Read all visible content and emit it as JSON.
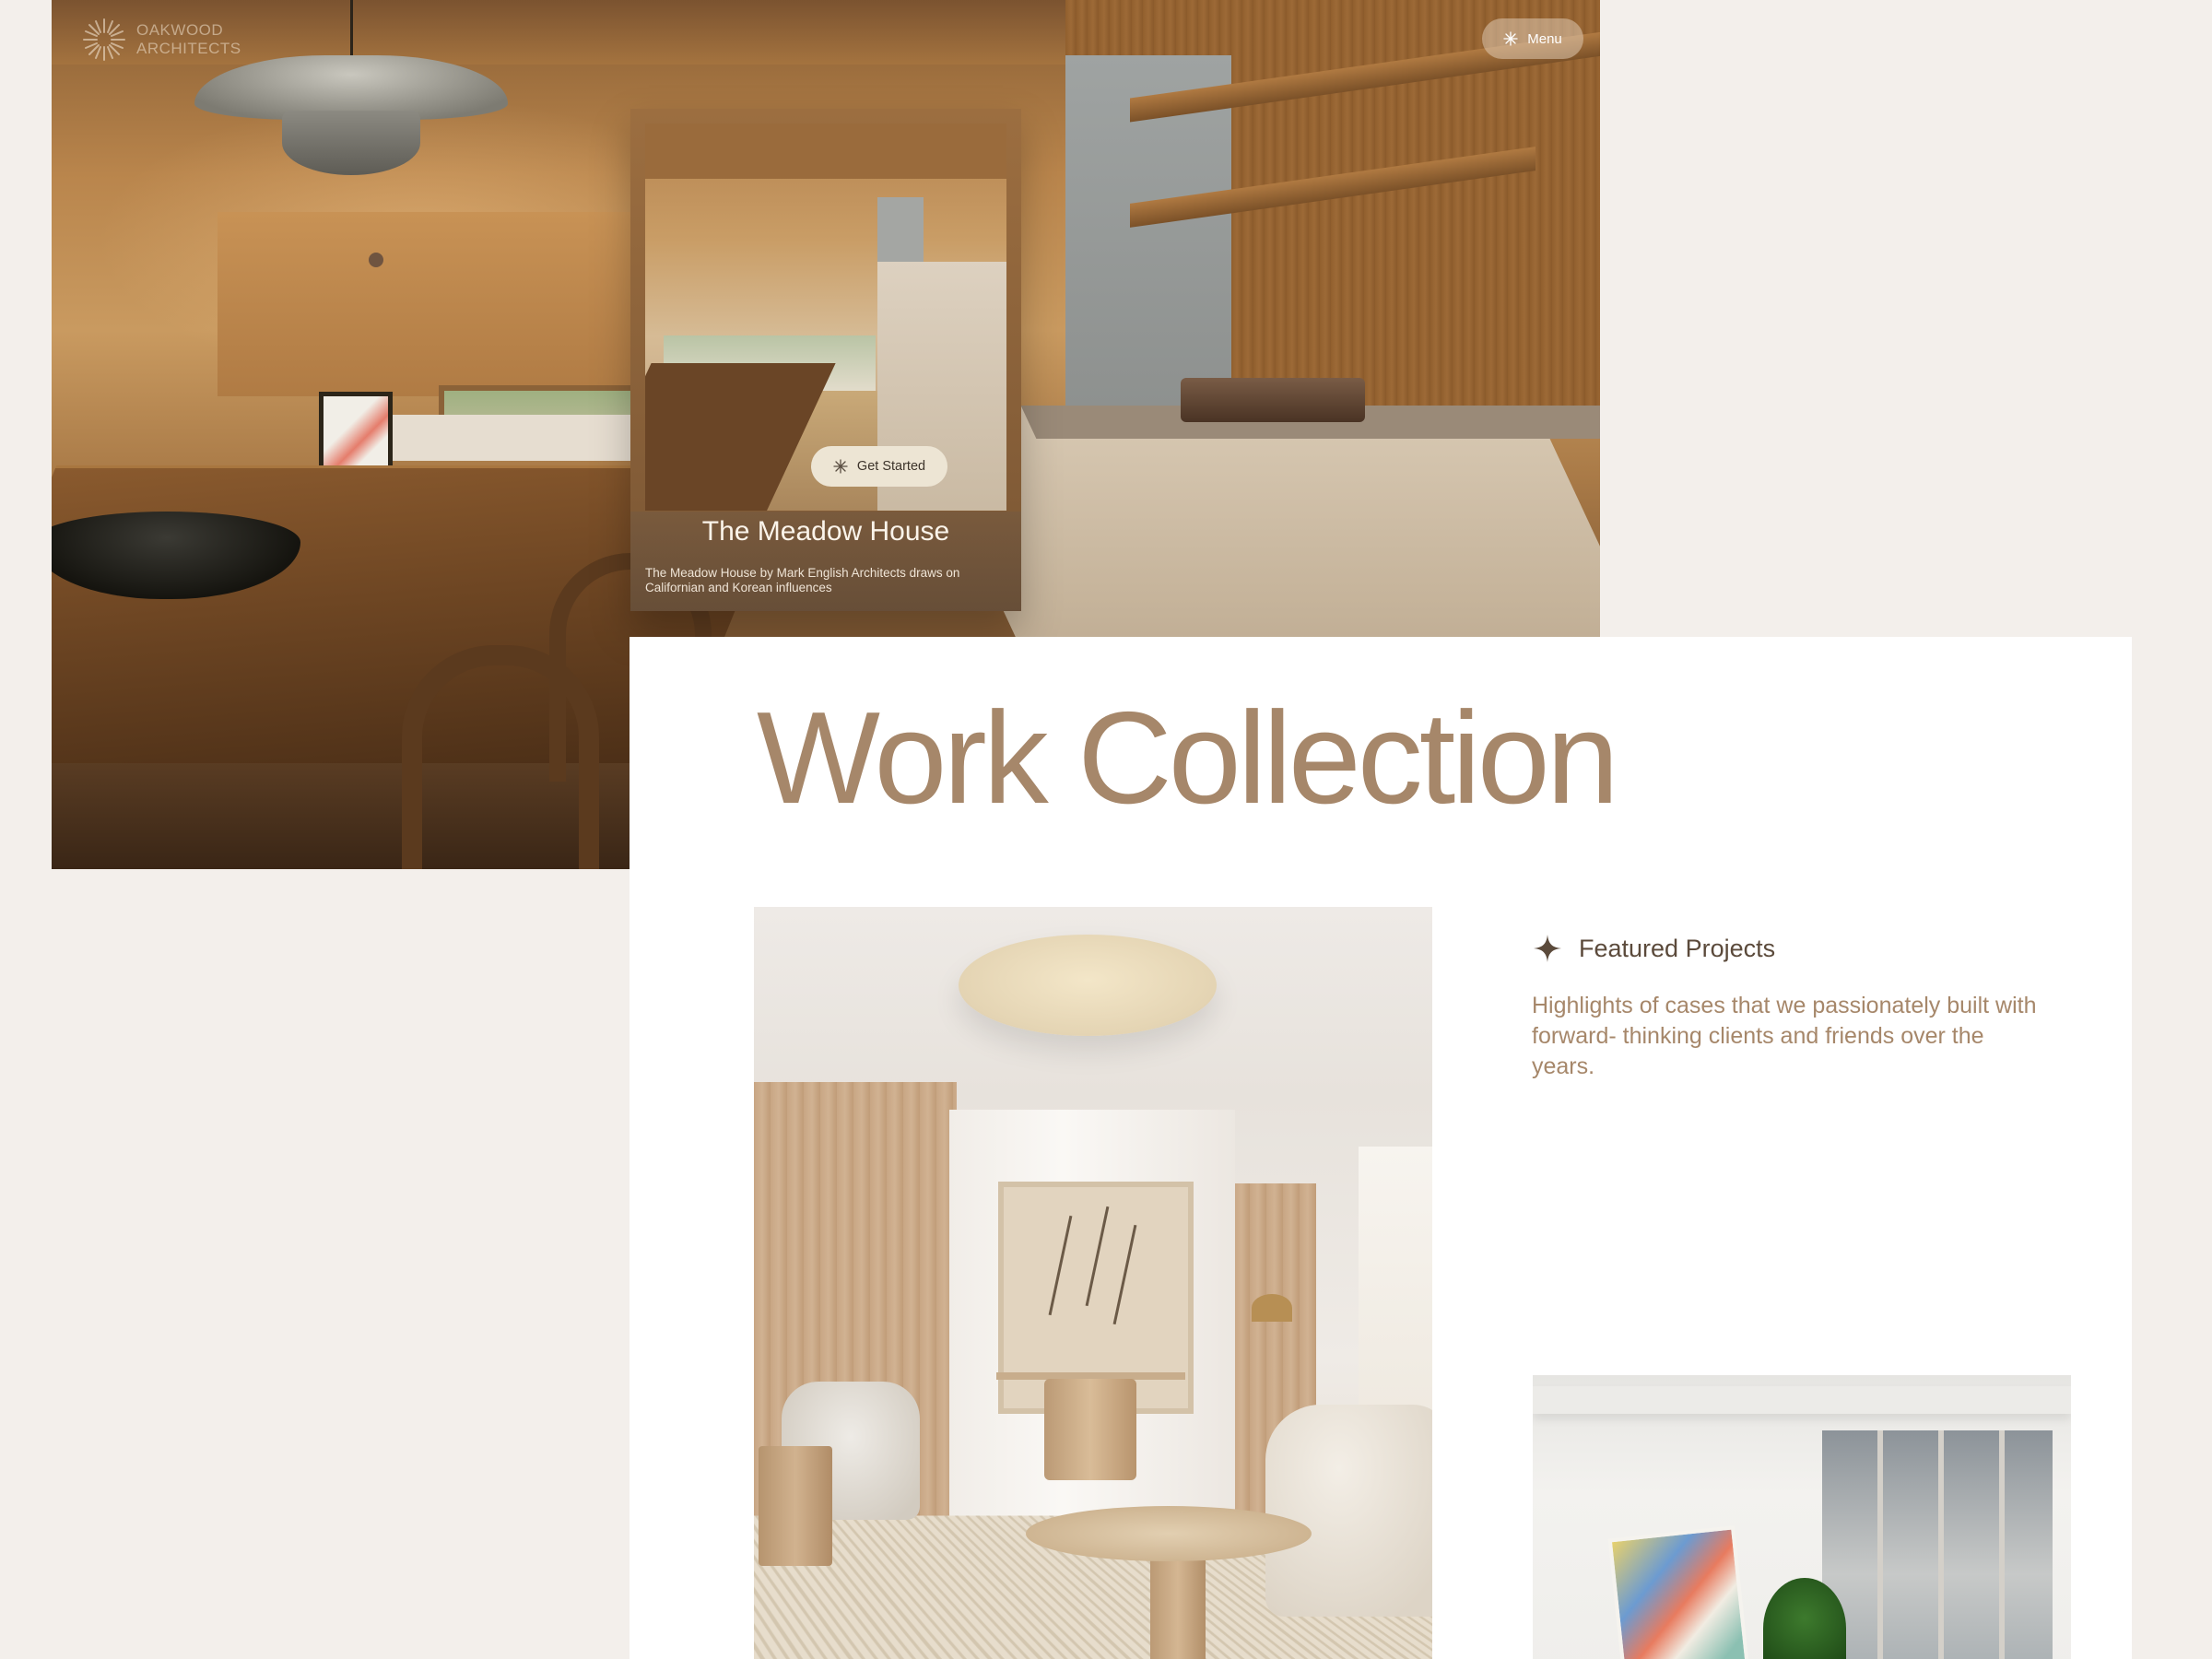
{
  "brand": {
    "name_line1": "OAKWOOD",
    "name_line2": "ARCHITECTS",
    "logo_icon": "sunburst-icon"
  },
  "header": {
    "menu_label": "Menu",
    "menu_icon": "sparkle-icon"
  },
  "hero": {
    "card_title": "The Meadow House",
    "card_description": "The Meadow House by Mark English Architects draws on Californian and Korean influences",
    "cta_label": "Get Started",
    "cta_icon": "sparkle-icon"
  },
  "work": {
    "title": "Work Collection",
    "featured_label": "Featured Projects",
    "featured_icon": "four-point-star-icon",
    "description": "Highlights of cases that we passionately built with forward- thinking clients and friends over the years."
  },
  "colors": {
    "background": "#f3efeb",
    "accent": "#a6876a",
    "dark_text": "#5b4a3b",
    "panel": "#ffffff"
  }
}
